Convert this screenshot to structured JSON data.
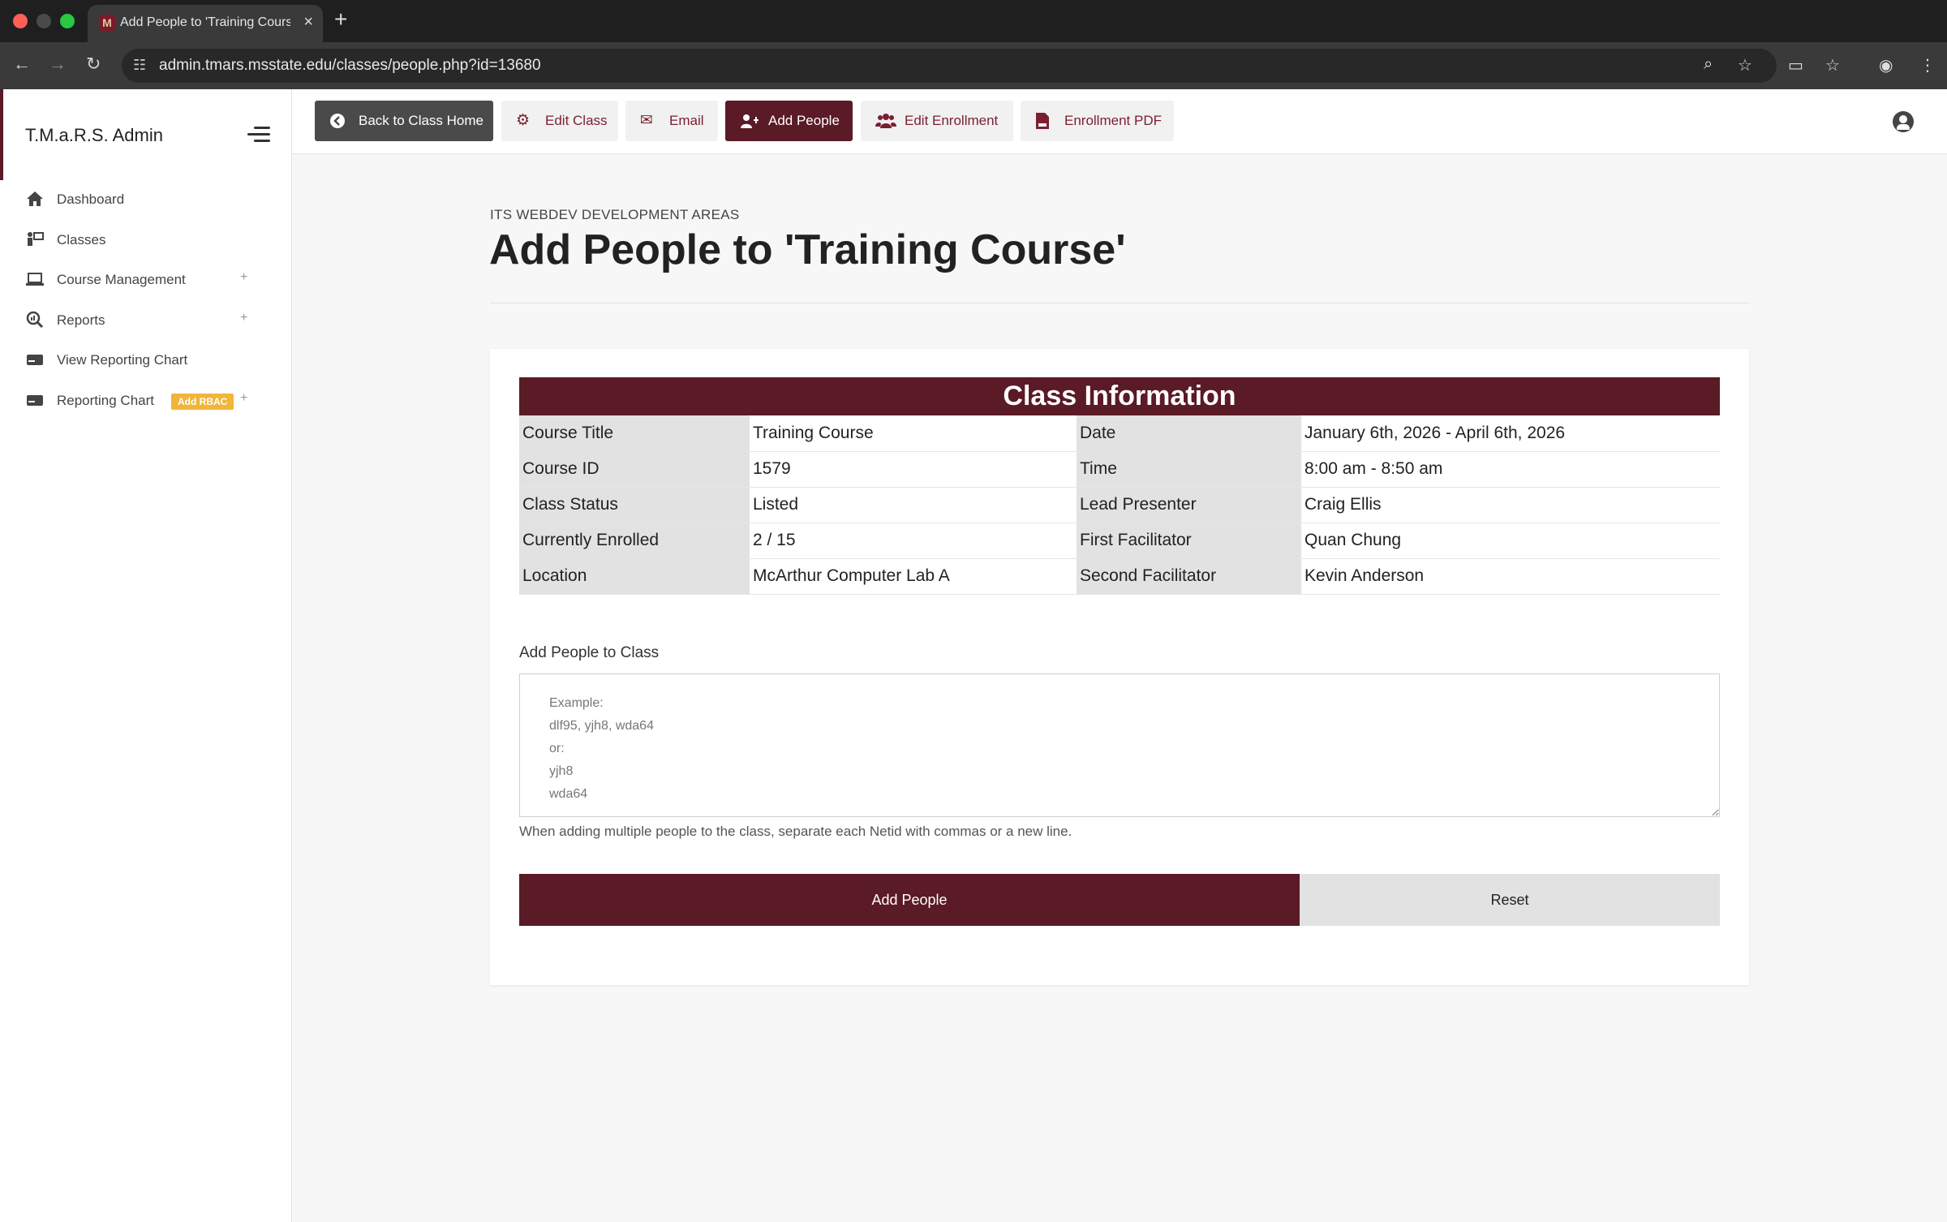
{
  "browser": {
    "tab_title": "Add People to 'Training Course'",
    "url": "admin.tmars.msstate.edu/classes/people.php?id=13680",
    "new_tab": "+"
  },
  "sidebar": {
    "brand": "T.M.a.R.S. Admin",
    "items": [
      {
        "label": "Dashboard",
        "icon": "home-icon"
      },
      {
        "label": "Classes",
        "icon": "presenter-icon"
      },
      {
        "label": "Course Management",
        "icon": "laptop-icon",
        "expand": "+"
      },
      {
        "label": "Reports",
        "icon": "search-chart-icon",
        "expand": "+"
      },
      {
        "label": "View Reporting Chart",
        "icon": "card-icon"
      },
      {
        "label": "Reporting Chart",
        "icon": "card-icon",
        "badge": "Add RBAC",
        "expand": "+"
      }
    ]
  },
  "toolbar": {
    "back": "Back to Class Home",
    "edit_class": "Edit Class",
    "email": "Email",
    "add_people": "Add People",
    "edit_enrollment": "Edit Enrollment",
    "enrollment_pdf": "Enrollment PDF"
  },
  "page": {
    "eyebrow": "ITS WEBDEV DEVELOPMENT AREAS",
    "title": "Add People to 'Training Course'"
  },
  "class_info": {
    "heading": "Class Information",
    "rows": [
      {
        "k1": "Course Title",
        "v1": "Training Course",
        "k2": "Date",
        "v2": "January 6th, 2026 - April 6th, 2026"
      },
      {
        "k1": "Course ID",
        "v1": "1579",
        "k2": "Time",
        "v2": "8:00 am - 8:50 am"
      },
      {
        "k1": "Class Status",
        "v1": "Listed",
        "k2": "Lead Presenter",
        "v2": "Craig Ellis"
      },
      {
        "k1": "Currently Enrolled",
        "v1": "2 / 15",
        "k2": "First Facilitator",
        "v2": "Quan Chung"
      },
      {
        "k1": "Location",
        "v1": "McArthur Computer Lab A",
        "k2": "Second Facilitator",
        "v2": "Kevin Anderson"
      }
    ]
  },
  "form": {
    "label": "Add People to Class",
    "placeholder": "Example:\ndlf95, yjh8, wda64\nor:\nyjh8\nwda64",
    "help": "When adding multiple people to the class, separate each Netid with commas or a new line.",
    "submit": "Add People",
    "reset": "Reset"
  },
  "colors": {
    "brand": "#5a1a26",
    "badge": "#f0b53a"
  }
}
